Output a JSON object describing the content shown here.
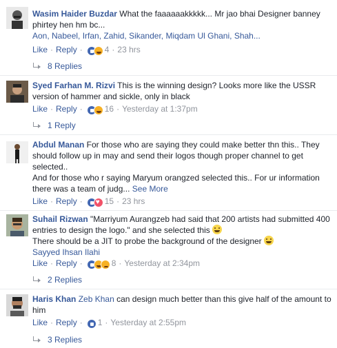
{
  "ui": {
    "like_label": "Like",
    "reply_label": "Reply",
    "see_more": "See More"
  },
  "comments": [
    {
      "author": "Wasim Haider Buzdar",
      "text": "What the faaaaaakkkkk... Mr jao bhai Designer banney phirtey hen hm bc...",
      "mentions": "Aon, Nabeel, Irfan, Zahid, Sikander, Miqdam Ul Ghani, Shah...",
      "reaction_count": "4",
      "timestamp": "23 hrs",
      "replies": "8 Replies",
      "reactions": [
        "like",
        "haha"
      ]
    },
    {
      "author": "Syed Farhan M. Rizvi",
      "text": "This is the winning design? Looks more like the USSR version of hammer and sickle, only in black",
      "reaction_count": "16",
      "timestamp": "Yesterday at 1:37pm",
      "replies": "1 Reply",
      "reactions": [
        "like",
        "haha"
      ]
    },
    {
      "author": "Abdul Manan",
      "text": "For those who are saying they could make better thn this.. They should follow up in may and send their logos though proper channel to get selected..",
      "text2": "And for those who r saying Maryum orangzed selected this.. For ur information there was a team of judg...",
      "reaction_count": "15",
      "timestamp": "23 hrs",
      "reactions": [
        "like",
        "love"
      ]
    },
    {
      "author": "Suhail Rizwan",
      "text": "\"Marriyum Aurangzeb had said that 200 artists had submitted 400 entries to design the logo.\" and she selected this",
      "text2": "There should be a JIT to probe the background of the designer",
      "mentions": "Sayyed Ihsan Ilahi",
      "reaction_count": "8",
      "timestamp": "Yesterday at 2:34pm",
      "replies": "2 Replies",
      "reactions": [
        "like",
        "haha",
        "sad"
      ]
    },
    {
      "author": "Haris Khan",
      "mention_inline": "Zeb Khan",
      "text": "can design much better than this give half of the amount to him",
      "reaction_count": "1",
      "timestamp": "Yesterday at 2:55pm",
      "replies": "3 Replies",
      "reactions": [
        "like"
      ]
    }
  ],
  "colors": {
    "link": "#365899",
    "meta": "#90949c",
    "text": "#1d2129",
    "like_blue": "#4267b2",
    "haha_yellow": "#f7b125",
    "love_red": "#f25268"
  },
  "icons": [
    "reply-arrow-icon",
    "like-reaction-icon",
    "haha-reaction-icon",
    "love-reaction-icon",
    "sad-reaction-icon",
    "grin-emoji-icon"
  ]
}
